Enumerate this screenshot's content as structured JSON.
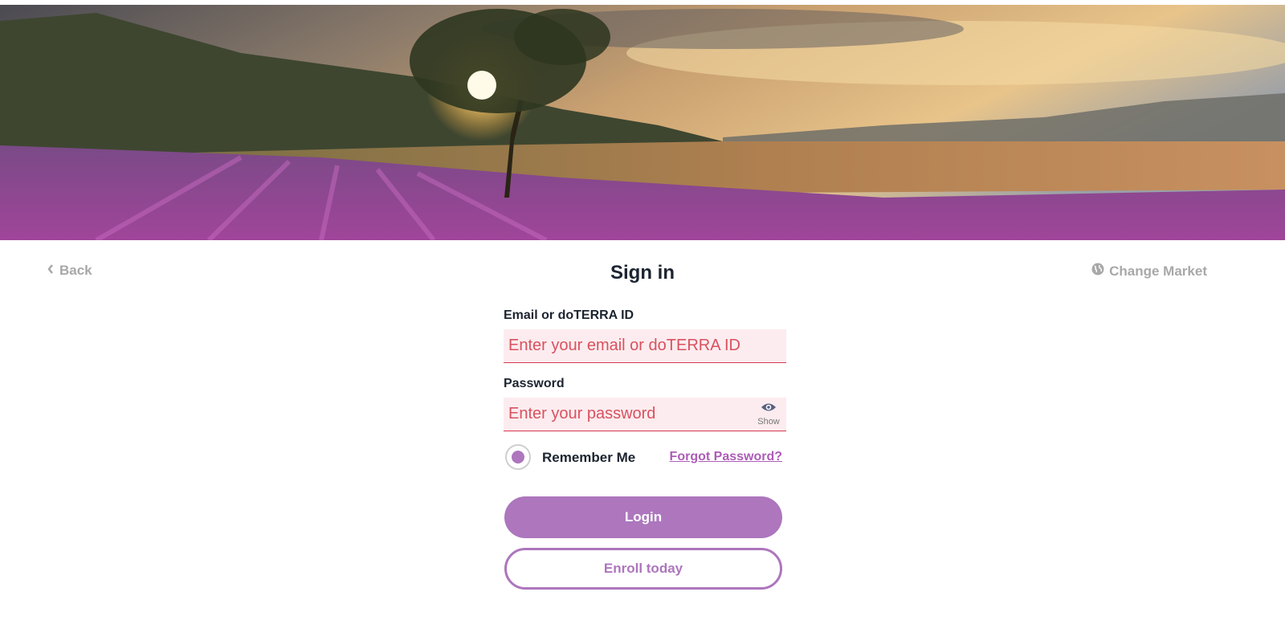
{
  "hero": {
    "icon": "lavender-field-sunset-image"
  },
  "nav": {
    "back_label": "Back",
    "change_market_label": "Change Market"
  },
  "page": {
    "title": "Sign in"
  },
  "form": {
    "email_label": "Email or doTERRA ID",
    "email_placeholder": "Enter your email or doTERRA ID",
    "email_value": "",
    "password_label": "Password",
    "password_placeholder": "Enter your password",
    "password_value": "",
    "show_label": "Show",
    "remember_label": "Remember Me",
    "remember_checked": true,
    "forgot_label": "Forgot Password?",
    "login_label": "Login",
    "enroll_label": "Enroll today"
  },
  "colors": {
    "accent": "#ad76bd",
    "error_red": "#d7394f",
    "input_bg": "#fcecef",
    "text_dark": "#1c2430",
    "muted": "#a8a8a8"
  }
}
